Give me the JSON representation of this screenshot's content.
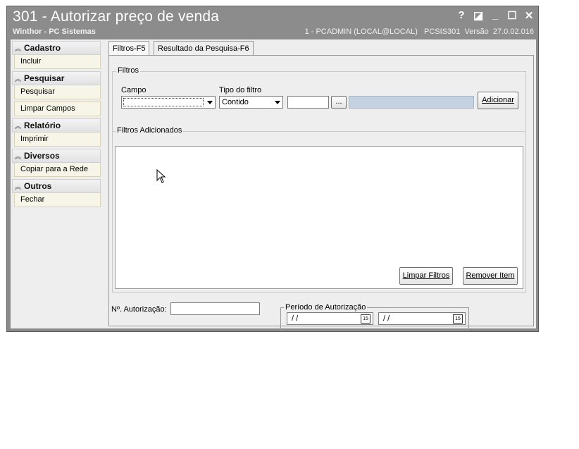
{
  "window": {
    "title": "301 - Autorizar preço de venda",
    "subtitle": "Winthor - PC Sistemas",
    "status": "1 - PCADMIN (LOCAL@LOCAL)   PCSIS301  Versão  27.0.02.016",
    "controls": {
      "help": "?",
      "restore": "◪",
      "minimize": "_",
      "maximize": "☐",
      "close": "✕"
    }
  },
  "sidebar": {
    "groups": [
      {
        "title": "Cadastro",
        "items": [
          "Incluir"
        ]
      },
      {
        "title": "Pesquisar",
        "items": [
          "Pesquisar",
          "Limpar Campos"
        ]
      },
      {
        "title": "Relatório",
        "items": [
          "Imprimir"
        ]
      },
      {
        "title": "Diversos",
        "items": [
          "Copiar para a Rede"
        ]
      },
      {
        "title": "Outros",
        "items": [
          "Fechar"
        ]
      }
    ]
  },
  "tabs": [
    "Filtros-F5",
    "Resultado da Pesquisa-F6"
  ],
  "filters": {
    "group_label": "Filtros",
    "campo_label": "Campo",
    "campo_value": "",
    "tipo_label": "Tipo do filtro",
    "tipo_value": "Contido",
    "ellipsis": "...",
    "add_button": "Adicionar"
  },
  "added_filters": {
    "group_label": "Filtros Adicionados",
    "clear_button": "Limpar Filtros",
    "remove_button": "Remover Item"
  },
  "authorization": {
    "number_label": "Nº. Autorização:",
    "number_value": "",
    "period_label": "Período de Autorização",
    "date_from": "/ /",
    "date_to": "/ /",
    "calendar_glyph": "15"
  }
}
